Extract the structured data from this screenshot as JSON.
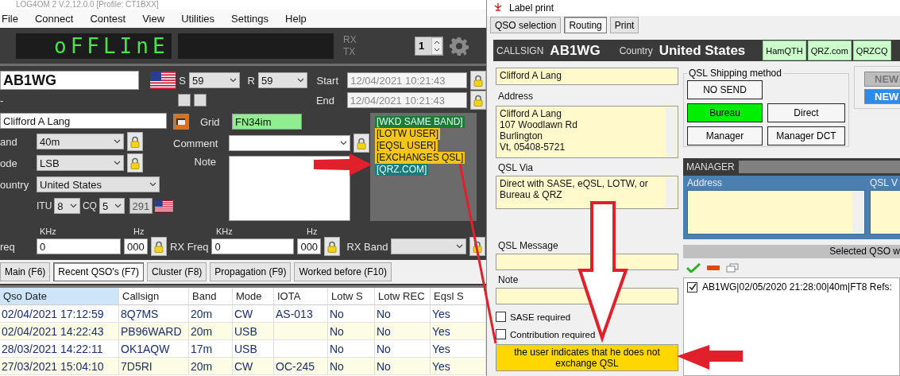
{
  "main_window": {
    "title": "LOG4OM 2 V.2.12.0.0 [Profile: CT1BXX]",
    "menu": [
      "File",
      "Connect",
      "Contest",
      "View",
      "Utilities",
      "Settings",
      "Help"
    ],
    "display": {
      "status": "oFFLInE",
      "rx_label": "RX",
      "tx_label": "TX",
      "spinner": "1"
    },
    "qso": {
      "callsign": "AB1WG",
      "s_label": "S",
      "s_report": "59",
      "r_label": "R",
      "r_report": "59",
      "start_label": "Start",
      "start": "12/04/2021 10:21:43",
      "end_label": "End",
      "end": "12/04/2021 10:21:43",
      "dash": "-",
      "name": "Clifford A Lang",
      "grid_label": "Grid",
      "grid": "FN34im",
      "band_label": "and",
      "band": "40m",
      "comment_label": "Comment",
      "mode_label": "ode",
      "mode": "LSB",
      "note_label": "Note",
      "country_label": "ountry",
      "country": "United States",
      "itu_label": "ITU",
      "itu": "8",
      "cq_label": "CQ",
      "cq": "5",
      "dxcc": "291"
    },
    "tags": [
      {
        "label": "[WKD SAME BAND]",
        "color": "#1e7b34"
      },
      {
        "label": "[LOTW USER]",
        "color": "#f5c518"
      },
      {
        "label": "[EQSL USER]",
        "color": "#f5c518"
      },
      {
        "label": "[EXCHANGES QSL]",
        "color": "#f5c518"
      },
      {
        "label": "[QRZ.COM]",
        "color": "#1b7a7a"
      }
    ],
    "freq": {
      "khz_label": "KHz",
      "hz_label": "Hz",
      "freq_label": "req",
      "freq_khz": "0",
      "freq_hz": "000",
      "rx_khz_label": "KHz",
      "rx_hz_label": "Hz",
      "rx_freq_label": "RX Freq",
      "rx_khz": "0",
      "rx_hz": "000",
      "rx_band_label": "RX Band"
    },
    "tabs": [
      {
        "label": "Main (F6)",
        "selected": false
      },
      {
        "label": "Recent QSO's (F7)",
        "selected": true
      },
      {
        "label": "Cluster (F8)",
        "selected": false
      },
      {
        "label": "Propagation (F9)",
        "selected": false
      },
      {
        "label": "Worked before (F10)",
        "selected": false
      }
    ],
    "table": {
      "columns": [
        {
          "label": "Qso Date",
          "selected": true
        },
        {
          "label": "Callsign",
          "selected": false
        },
        {
          "label": "Band",
          "selected": false
        },
        {
          "label": "Mode",
          "selected": false
        },
        {
          "label": "IOTA",
          "selected": false
        },
        {
          "label": "Lotw S",
          "selected": false
        },
        {
          "label": "Lotw REC",
          "selected": false
        },
        {
          "label": "Eqsl S",
          "selected": false
        }
      ],
      "rows": [
        [
          "02/04/2021 17:12:59",
          "8Q7MS",
          "20m",
          "CW",
          "AS-013",
          "No",
          "No",
          "Yes"
        ],
        [
          "02/04/2021 14:22:43",
          "PB96WARD",
          "20m",
          "USB",
          "",
          "No",
          "No",
          "Yes"
        ],
        [
          "28/03/2021 14:22:11",
          "OK1AQW",
          "17m",
          "USB",
          "",
          "No",
          "No",
          "Yes"
        ],
        [
          "27/03/2021 15:04:10",
          "7D5RI",
          "20m",
          "CW",
          "OC-245",
          "No",
          "No",
          "Yes"
        ]
      ]
    }
  },
  "label_print": {
    "title": "Label print",
    "tabs": [
      {
        "label": "QSO selection",
        "selected": false
      },
      {
        "label": "Routing",
        "selected": true
      },
      {
        "label": "Print",
        "selected": false
      }
    ],
    "header": {
      "callsign_label": "CALLSIGN",
      "callsign": "AB1WG",
      "country_label": "Country",
      "country": "United States",
      "lookups": [
        "HamQTH",
        "QRZ.com",
        "QRZCQ"
      ]
    },
    "name": "Clifford A Lang",
    "address_label": "Address",
    "address": [
      "Clifford A Lang",
      "107 Woodlawn Rd",
      "Burlington",
      "Vt, 05408-5721"
    ],
    "qsl_via_label": "QSL Via",
    "qsl_via": "Direct with SASE, eQSL, LOTW, or Bureau & QRZ",
    "qsl_message_label": "QSL Message",
    "note_label": "Note",
    "checks": [
      {
        "label": "SASE required",
        "checked": false
      },
      {
        "label": "Contribution required",
        "checked": false
      }
    ],
    "warning": "the user indicates that he does not exchange QSL",
    "shipping": {
      "title": "QSL Shipping method",
      "methods": [
        {
          "label": "NO SEND",
          "selected": false
        },
        {
          "label": "Bureau",
          "selected": true
        },
        {
          "label": "Direct",
          "selected": false
        },
        {
          "label": "Manager",
          "selected": false
        },
        {
          "label": "Manager DCT",
          "selected": false
        }
      ]
    },
    "new_buttons": [
      {
        "label": "NEW",
        "disabled": true
      },
      {
        "label": "NEW",
        "disabled": false
      }
    ],
    "manager": {
      "title": "MANAGER",
      "address_label": "Address",
      "qsl_via_label": "QSL V"
    },
    "selected_bar": "Selected QSO w",
    "qso_list": [
      {
        "text": "AB1WG|02/05/2020 21:28:00|40m|FT8 Refs:",
        "checked": true
      }
    ]
  }
}
